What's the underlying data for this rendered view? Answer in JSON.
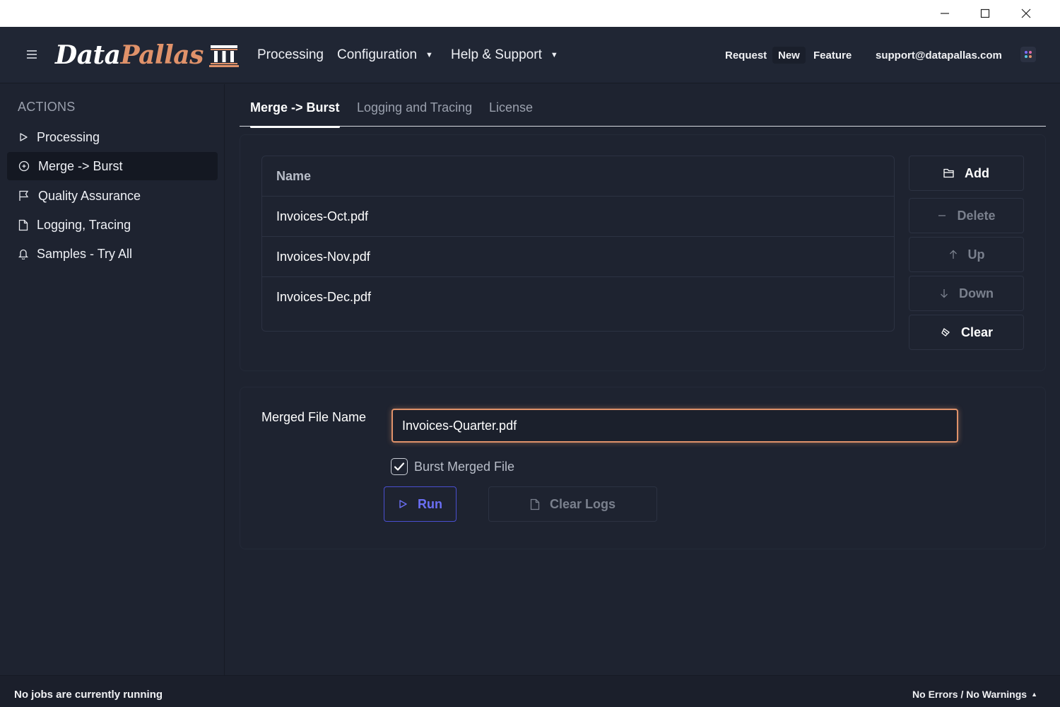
{
  "window": {
    "minimize_icon": "minimize-icon",
    "maximize_icon": "maximize-icon",
    "close_icon": "close-icon"
  },
  "header": {
    "logo_part1": "Data",
    "logo_part2": "Pallas",
    "nav": [
      {
        "label": "Processing"
      },
      {
        "label": "Configuration",
        "caret": "▼"
      },
      {
        "label": "Help & Support",
        "caret": "▼"
      }
    ],
    "request": "Request",
    "new": "New",
    "feature": "Feature",
    "email": "support@datapallas.com"
  },
  "sidebar": {
    "title": "ACTIONS",
    "items": [
      {
        "label": "Processing",
        "icon": "play-icon"
      },
      {
        "label": "Merge -> Burst",
        "icon": "plus-circle-icon",
        "active": true
      },
      {
        "label": "Quality Assurance",
        "icon": "flag-icon"
      },
      {
        "label": "Logging, Tracing",
        "icon": "file-icon"
      },
      {
        "label": "Samples - Try All",
        "icon": "bell-icon"
      }
    ]
  },
  "tabs": [
    {
      "label": "Merge -> Burst",
      "active": true
    },
    {
      "label": "Logging and Tracing"
    },
    {
      "label": "License"
    }
  ],
  "files": {
    "header": "Name",
    "rows": [
      "Invoices-Oct.pdf",
      "Invoices-Nov.pdf",
      "Invoices-Dec.pdf"
    ]
  },
  "buttons": {
    "add": "Add",
    "delete": "Delete",
    "up": "Up",
    "down": "Down",
    "clear": "Clear"
  },
  "merge": {
    "label": "Merged File Name",
    "value": "Invoices-Quarter.pdf",
    "burst_label": "Burst Merged File",
    "burst_checked": true,
    "run": "Run",
    "clear_logs": "Clear Logs"
  },
  "status": {
    "left": "No jobs are currently running",
    "right": "No Errors / No Warnings",
    "right_caret": "▲"
  },
  "colors": {
    "accent": "#e0926a",
    "primary": "#6b6ff5",
    "background": "#1e2330"
  }
}
